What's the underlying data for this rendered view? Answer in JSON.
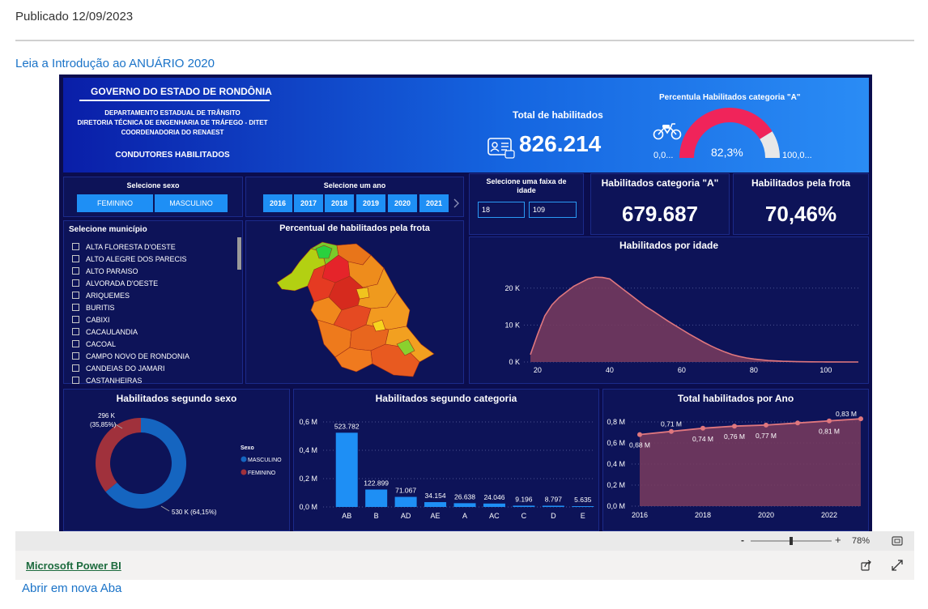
{
  "page": {
    "published": "Publicado 12/09/2023",
    "intro_link": "Leia a Introdução ao ANUÁRIO 2020",
    "open_new_tab": "Abrir em nova Aba"
  },
  "header": {
    "government": "GOVERNO DO ESTADO DE RONDÔNIA",
    "department_lines": [
      "DEPARTAMENTO ESTADUAL DE TRÂNSITO",
      "DIRETORIA TÉCNICA DE ENGENHARIA DE TRÁFEGO  - DITET",
      "COORDENADORIA DO RENAEST"
    ],
    "subtitle": "CONDUTORES HABILITADOS",
    "total_title": "Total de habilitados",
    "total_value": "826.214",
    "gauge_title": "Percentula Habilitados categoria \"A\"",
    "gauge_min": "0,0...",
    "gauge_max": "100,0...",
    "gauge_value": "82,3%",
    "gauge_fraction": 0.823,
    "colors": {
      "gauge_fill": "#f0245a",
      "gauge_rest": "#e8e8e8"
    }
  },
  "filters": {
    "sex_title": "Selecione sexo",
    "sex_options": [
      "FEMININO",
      "MASCULINO"
    ],
    "year_title": "Selecione um ano",
    "years": [
      "2016",
      "2017",
      "2018",
      "2019",
      "2020",
      "2021"
    ],
    "age_title": "Selecione uma faixa de idade",
    "age_min": "18",
    "age_max": "109",
    "municipality_title": "Selecione município",
    "municipalities": [
      "ALTA FLORESTA D'OESTE",
      "ALTO ALEGRE DOS PARECIS",
      "ALTO PARAISO",
      "ALVORADA D'OESTE",
      "ARIQUEMES",
      "BURITIS",
      "CABIXI",
      "CACAULANDIA",
      "CACOAL",
      "CAMPO NOVO DE RONDONIA",
      "CANDEIAS DO JAMARI",
      "CASTANHEIRAS"
    ]
  },
  "kpis": {
    "cat_a_title": "Habilitados categoria \"A\"",
    "cat_a_value": "679.687",
    "fleet_title": "Habilitados pela frota",
    "fleet_value": "70,46%"
  },
  "map": {
    "title": "Percentual de habilitados pela frota"
  },
  "chart_data": [
    {
      "type": "area",
      "title": "Habilitados por idade",
      "x_ticks": [
        "20",
        "40",
        "60",
        "80",
        "100"
      ],
      "y_ticks": [
        "0 K",
        "10 K",
        "20 K"
      ],
      "xlim": [
        18,
        109
      ],
      "ylim": [
        0,
        25000
      ],
      "x": [
        18,
        20,
        22,
        24,
        26,
        28,
        30,
        32,
        34,
        36,
        38,
        40,
        42,
        44,
        46,
        48,
        50,
        52,
        54,
        56,
        58,
        60,
        62,
        64,
        66,
        68,
        70,
        72,
        74,
        76,
        78,
        80,
        84,
        88,
        92,
        96,
        100,
        109
      ],
      "y": [
        2000,
        7500,
        12500,
        15500,
        17500,
        19000,
        20500,
        21500,
        22500,
        23000,
        22900,
        22500,
        21000,
        19500,
        18000,
        16500,
        15000,
        13800,
        12500,
        11200,
        10000,
        8800,
        7600,
        6500,
        5400,
        4400,
        3500,
        2700,
        2000,
        1500,
        1100,
        800,
        400,
        200,
        100,
        50,
        20,
        0
      ],
      "colors": {
        "line": "#e0777e",
        "fill": "#7a3c5e"
      }
    },
    {
      "type": "donut",
      "title": "Habilitados segundo sexo",
      "legend_title": "Sexo",
      "series": [
        {
          "name": "MASCULINO",
          "value": 530,
          "label": "530 K (64,15%)",
          "color": "#1565c0"
        },
        {
          "name": "FEMININO",
          "value": 296,
          "label": "296 K\n(35,85%)",
          "color": "#a0313c"
        }
      ]
    },
    {
      "type": "bar",
      "title": "Habilitados segundo categoria",
      "categories": [
        "AB",
        "B",
        "AD",
        "AE",
        "A",
        "AC",
        "C",
        "D",
        "E"
      ],
      "values": [
        523782,
        122899,
        71067,
        34154,
        26638,
        24046,
        9196,
        8797,
        5635
      ],
      "labels": [
        "523.782",
        "122.899",
        "71.067",
        "34.154",
        "26.638",
        "24.046",
        "9.196",
        "8.797",
        "5.635"
      ],
      "y_ticks": [
        "0,0 M",
        "0,2 M",
        "0,4 M",
        "0,6 M"
      ],
      "ylim": [
        0,
        600000
      ],
      "colors": {
        "bar": "#1e8ff5"
      }
    },
    {
      "type": "area",
      "title": "Total habilitados por Ano",
      "x": [
        2016,
        2017,
        2018,
        2019,
        2020,
        2021,
        2022,
        2023
      ],
      "y": [
        0.68,
        0.71,
        0.74,
        0.76,
        0.77,
        0.79,
        0.81,
        0.83
      ],
      "point_labels": [
        "0,68 M",
        "0,71 M",
        "0,74 M",
        "0,76 M",
        "0,77 M",
        "",
        "0,81 M",
        "0,83 M"
      ],
      "x_ticks": [
        "2016",
        "2018",
        "2020",
        "2022"
      ],
      "y_ticks": [
        "0,0 M",
        "0,2 M",
        "0,4 M",
        "0,6 M",
        "0,8 M"
      ],
      "ylim": [
        0,
        0.8
      ],
      "colors": {
        "line": "#e0777e",
        "fill": "#7a3c5e"
      }
    }
  ],
  "footer": {
    "zoom_minus": "-",
    "zoom_plus": "+",
    "zoom": "78%",
    "zoom_fraction": 0.5,
    "pbi_link": "Microsoft Power BI"
  }
}
